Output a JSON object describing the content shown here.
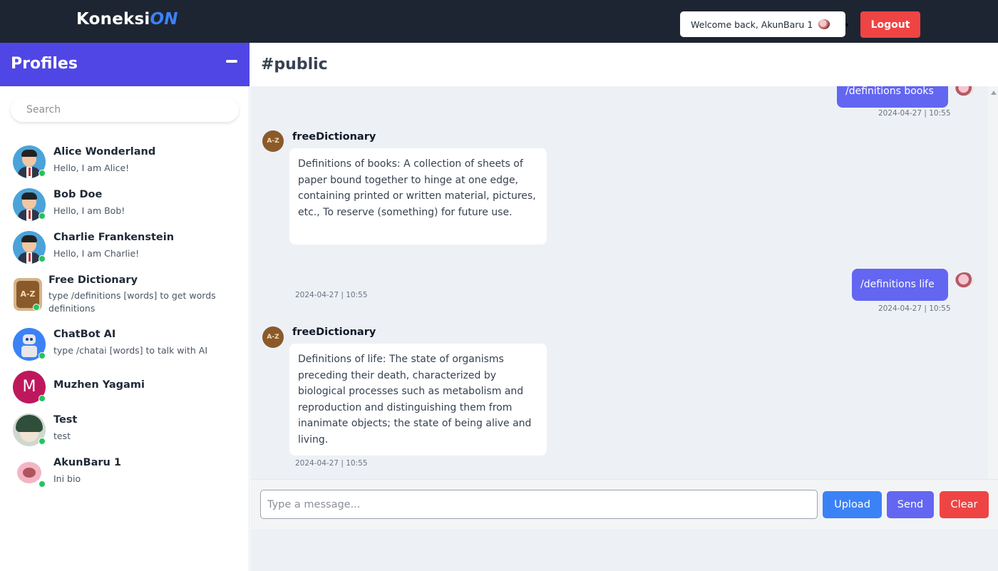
{
  "app": {
    "brand_main": "Koneksi",
    "brand_accent": "ON"
  },
  "header": {
    "welcome_text": "Welcome back, AkunBaru 1",
    "logout_label": "Logout"
  },
  "sidebar": {
    "title": "Profiles",
    "search_placeholder": "Search",
    "profiles": [
      {
        "name": "Alice Wonderland",
        "bio": "Hello, I am Alice!",
        "avatar": "man-avatar-icon",
        "online": true
      },
      {
        "name": "Bob Doe",
        "bio": "Hello, I am Bob!",
        "avatar": "man-avatar-icon",
        "online": true
      },
      {
        "name": "Charlie Frankenstein",
        "bio": "Hello, I am Charlie!",
        "avatar": "man-avatar-icon",
        "online": true
      },
      {
        "name": "Free Dictionary",
        "bio": "type /definitions [words] to get words definitions",
        "avatar": "dictionary-book-icon",
        "avatar_text": "A-Z",
        "online": true
      },
      {
        "name": "ChatBot AI",
        "bio": "type /chatai [words] to talk with AI",
        "avatar": "robot-icon",
        "online": true
      },
      {
        "name": "Muzhen Yagami",
        "bio": "",
        "avatar": "letter-avatar",
        "avatar_text": "M",
        "online": true
      },
      {
        "name": "Test",
        "bio": "test",
        "avatar": "anime-avatar-icon",
        "online": true
      },
      {
        "name": "AkunBaru 1",
        "bio": "Ini bio",
        "avatar": "pink-avatar-icon",
        "online": true
      }
    ]
  },
  "chat": {
    "channel": "#public",
    "messages": [
      {
        "direction": "outgoing",
        "text": "/definitions books",
        "time": "2024-04-27 | 10:55"
      },
      {
        "direction": "incoming",
        "sender": "freeDictionary",
        "avatar_text": "A-Z",
        "text": "Definitions of books: A collection of sheets of paper bound together to hinge at one edge, containing printed or written material, pictures, etc., To reserve (something) for future use.",
        "time": "2024-04-27 | 10:55"
      },
      {
        "direction": "outgoing",
        "text": "/definitions life",
        "time": "2024-04-27 | 10:55"
      },
      {
        "direction": "incoming",
        "sender": "freeDictionary",
        "avatar_text": "A-Z",
        "text": "Definitions of life: The state of organisms preceding their death, characterized by biological processes such as metabolism and reproduction and distinguishing them from inanimate objects; the state of being alive and living.",
        "time": "2024-04-27 | 10:55"
      }
    ]
  },
  "composer": {
    "placeholder": "Type a message...",
    "upload_label": "Upload",
    "send_label": "Send",
    "clear_label": "Clear"
  },
  "colors": {
    "topbar": "#1e2532",
    "profiles_header": "#4f46e5",
    "outgoing_bubble": "#6366f1",
    "upload": "#3b82f6",
    "send": "#6366f1",
    "clear": "#ef4444",
    "online": "#22c55e"
  }
}
